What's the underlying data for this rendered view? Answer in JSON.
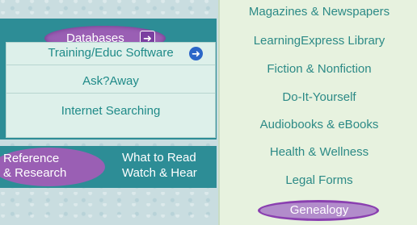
{
  "menu": {
    "databases_label": "Databases",
    "submenu_items": [
      "Training/Educ Software",
      "Ask?Away",
      "Internet Searching"
    ]
  },
  "bottom_nav": {
    "reference_label_line1": "Reference",
    "reference_label_line2": "& Research",
    "link_1": "What to Read",
    "link_2": "Watch & Hear"
  },
  "databases_flyout": {
    "items": [
      "Magazines & Newspapers",
      "LearningExpress Library",
      "Fiction & Nonfiction",
      "Do-It-Yourself",
      "Audiobooks & eBooks",
      "Health & Wellness",
      "Legal Forms",
      "Genealogy"
    ],
    "highlighted_item": "Genealogy"
  },
  "colors": {
    "teal": "#2d8d96",
    "purple": "#9a5fb4",
    "flyout_bg": "#e7f2df",
    "link_text": "#2c8a86"
  },
  "icons": {
    "databases_arrow": "arrow-right-icon",
    "training_arrow": "arrow-right-circle-icon"
  }
}
